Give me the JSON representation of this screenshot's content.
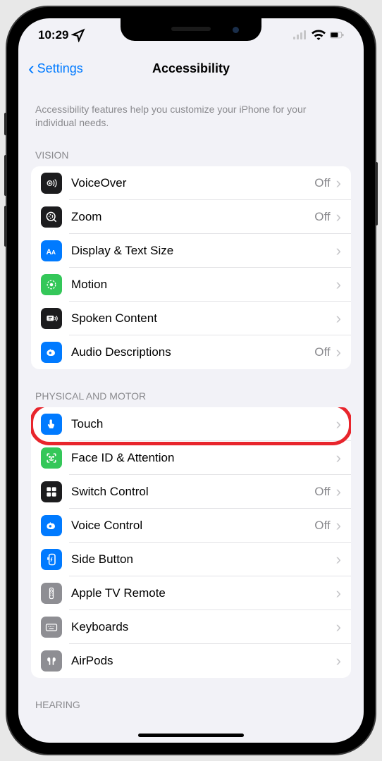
{
  "status_bar": {
    "time": "10:29"
  },
  "nav": {
    "back_label": "Settings",
    "title": "Accessibility"
  },
  "description": "Accessibility features help you customize your iPhone for your individual needs.",
  "sections": [
    {
      "header": "VISION",
      "rows": [
        {
          "label": "VoiceOver",
          "status": "Off",
          "icon": "voiceover",
          "bg": "bg-black"
        },
        {
          "label": "Zoom",
          "status": "Off",
          "icon": "zoom",
          "bg": "bg-black"
        },
        {
          "label": "Display & Text Size",
          "status": "",
          "icon": "textsize",
          "bg": "bg-blue"
        },
        {
          "label": "Motion",
          "status": "",
          "icon": "motion",
          "bg": "bg-green"
        },
        {
          "label": "Spoken Content",
          "status": "",
          "icon": "spoken",
          "bg": "bg-black"
        },
        {
          "label": "Audio Descriptions",
          "status": "Off",
          "icon": "audiodesc",
          "bg": "bg-blue"
        }
      ]
    },
    {
      "header": "PHYSICAL AND MOTOR",
      "rows": [
        {
          "label": "Touch",
          "status": "",
          "icon": "touch",
          "bg": "bg-blue",
          "highlighted": true
        },
        {
          "label": "Face ID & Attention",
          "status": "",
          "icon": "faceid",
          "bg": "bg-green"
        },
        {
          "label": "Switch Control",
          "status": "Off",
          "icon": "switch",
          "bg": "bg-black"
        },
        {
          "label": "Voice Control",
          "status": "Off",
          "icon": "voicecontrol",
          "bg": "bg-blue"
        },
        {
          "label": "Side Button",
          "status": "",
          "icon": "sidebutton",
          "bg": "bg-blue"
        },
        {
          "label": "Apple TV Remote",
          "status": "",
          "icon": "tvremote",
          "bg": "bg-gray"
        },
        {
          "label": "Keyboards",
          "status": "",
          "icon": "keyboard",
          "bg": "bg-gray"
        },
        {
          "label": "AirPods",
          "status": "",
          "icon": "airpods",
          "bg": "bg-gray"
        }
      ]
    },
    {
      "header": "HEARING",
      "rows": []
    }
  ]
}
